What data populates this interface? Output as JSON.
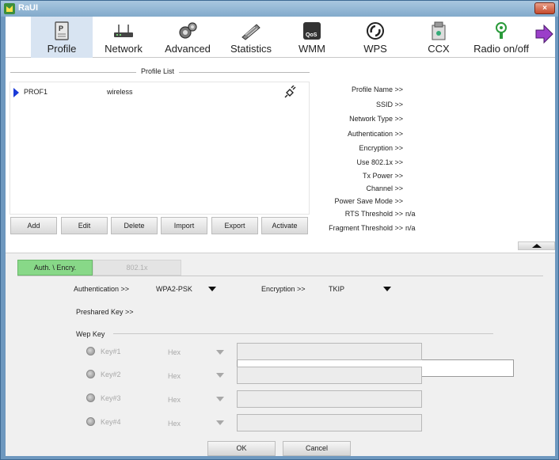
{
  "window": {
    "title": "RaUI",
    "close_label": "×"
  },
  "toolbar": {
    "items": [
      {
        "label": "Profile",
        "icon": "profile-icon"
      },
      {
        "label": "Network",
        "icon": "network-icon"
      },
      {
        "label": "Advanced",
        "icon": "advanced-icon"
      },
      {
        "label": "Statistics",
        "icon": "statistics-icon"
      },
      {
        "label": "WMM",
        "icon": "wmm-icon"
      },
      {
        "label": "WPS",
        "icon": "wps-icon"
      },
      {
        "label": "CCX",
        "icon": "ccx-icon"
      },
      {
        "label": "Radio on/off",
        "icon": "radio-icon"
      }
    ],
    "active_index": 0,
    "next_icon": "next-arrow-icon",
    "wmm_icon_text": "QoS"
  },
  "profile_list": {
    "legend": "Profile List",
    "rows": [
      {
        "name": "PROF1",
        "type": "wireless"
      }
    ],
    "buttons": {
      "add": "Add",
      "edit": "Edit",
      "delete": "Delete",
      "import": "Import",
      "export": "Export",
      "activate": "Activate"
    }
  },
  "profile_details": {
    "profile_name": "Profile Name >>",
    "ssid": "SSID >>",
    "network_type": "Network Type >>",
    "authentication": "Authentication >>",
    "encryption": "Encryption >>",
    "use_8021x": "Use 802.1x >>",
    "tx_power": "Tx Power >>",
    "channel": "Channel >>",
    "power_save_mode": "Power Save Mode >>",
    "rts_threshold": "RTS Threshold >>",
    "rts_threshold_value": "n/a",
    "fragment_threshold": "Fragment Threshold >>",
    "fragment_threshold_value": "n/a"
  },
  "security": {
    "tabs": {
      "auth": "Auth. \\ Encry.",
      "x8021": "802.1x"
    },
    "authentication_label": "Authentication >>",
    "authentication_value": "WPA2-PSK",
    "encryption_label": "Encryption >>",
    "encryption_value": "TKIP",
    "preshared_key_label": "Preshared Key >>",
    "preshared_key_value": "",
    "wep_key_legend": "Wep Key",
    "keys": [
      {
        "label": "Key#1",
        "format": "Hex",
        "value": ""
      },
      {
        "label": "Key#2",
        "format": "Hex",
        "value": ""
      },
      {
        "label": "Key#3",
        "format": "Hex",
        "value": ""
      },
      {
        "label": "Key#4",
        "format": "Hex",
        "value": ""
      }
    ]
  },
  "buttons": {
    "ok": "OK",
    "cancel": "Cancel"
  }
}
